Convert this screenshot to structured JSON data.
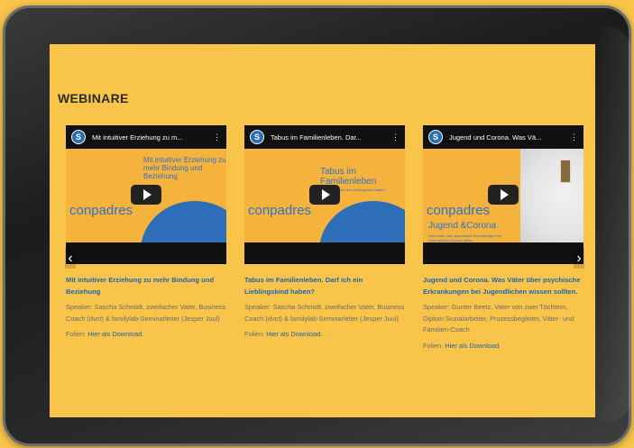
{
  "section": {
    "title": "WEBINARE"
  },
  "colors": {
    "background": "#f8c54a",
    "link": "#1e63b0",
    "text": "#6a6a6a"
  },
  "carousel": {
    "prev_icon": "chevron-left-icon",
    "next_icon": "chevron-right-icon",
    "cards": [
      {
        "video": {
          "title": "Mit intuitiver Erziehung zu m...",
          "brand": "conpadres",
          "overlay": "Mit intuitiver Erziehung zu mehr Bindung und Beziehung"
        },
        "title": "Mit intuitiver Erziehung zu mehr Bindung und Beziehung",
        "speaker": "Speaker: Sascha Schmidt,  zweifacher Vater, Business Coach (dvct) & familylab-Seminarleiter (Jesper Juul)",
        "slides_label": "Folien:",
        "slides_link": "Hier als Download."
      },
      {
        "video": {
          "title": "Tabus im Familienleben. Dar...",
          "brand": "conpadres",
          "overlay": "Tabus im Familienleben",
          "tagline": "Darf ich ein Lieblingskind haben?"
        },
        "title": "Tabus im Familienleben. Darf ich ein Lieblingskind haben?",
        "speaker": "Speaker: Sascha Schmidt,  zweifacher Vater, Business Coach (dvct) & familylab-Seminarleiter (Jesper Juul)",
        "slides_label": "Folien:",
        "slides_link": "Hier als Download."
      },
      {
        "video": {
          "title": "Jugend und Corona. Was Vä...",
          "brand": "conpadres",
          "overlay": "Jugend &Corona",
          "tagline": "Was Väter über psychische Erkrankungen bei Jugendlichen wissen sollten"
        },
        "title": "Jugend und Corona. Was Väter über psychische Erkrankungen bei Jugendlichen wissen sollten.",
        "speaker": "Speaker: Gunter Beetz, Vater von zwei Töchtern, Diplom Sozialarbeiter, Prozessbegleiter, Väter- und Familien-Coach",
        "slides_label": "Folien:",
        "slides_link": "Hier als Download."
      }
    ]
  }
}
